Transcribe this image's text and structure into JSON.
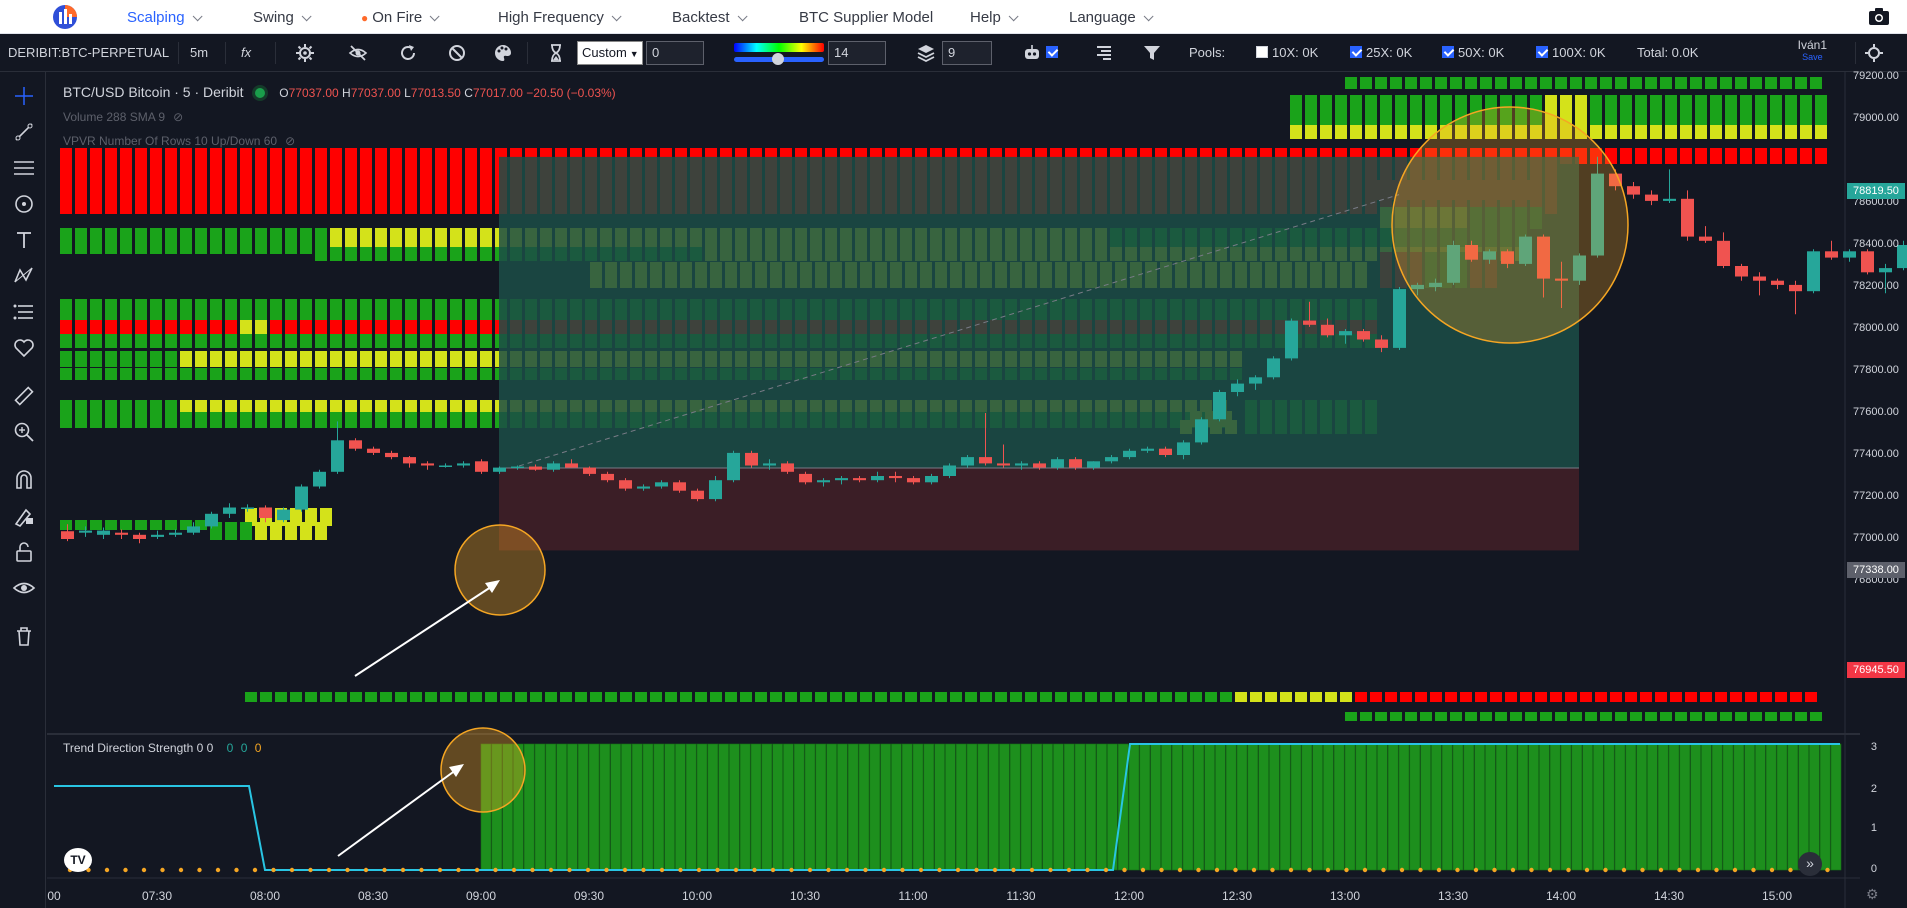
{
  "nav": {
    "items": [
      {
        "label": "Scalping",
        "active": true,
        "chevron": true
      },
      {
        "label": "Swing",
        "chevron": true
      },
      {
        "label": "On Fire",
        "chevron": true,
        "icon": "fire-icon"
      },
      {
        "label": "High Frequency",
        "chevron": true
      },
      {
        "label": "Backtest",
        "chevron": true
      },
      {
        "label": "BTC Supplier Model",
        "chevron": false
      },
      {
        "label": "Help",
        "chevron": true
      },
      {
        "label": "Language",
        "chevron": true
      }
    ],
    "camera_icon": "camera-icon"
  },
  "toolbar": {
    "symbol": "DERIBIT:BTC-PERPETUAL",
    "interval": "5m",
    "fx": "fx",
    "select_value": "Custom",
    "custom_input": "0",
    "gradient_input": "14",
    "layers_input": "9",
    "pools_label": "Pools:",
    "pools": [
      {
        "label": "10X: 0K",
        "checked": false
      },
      {
        "label": "25X: 0K",
        "checked": true
      },
      {
        "label": "50X: 0K",
        "checked": true
      },
      {
        "label": "100X: 0K",
        "checked": true
      }
    ],
    "total": "Total: 0.0K",
    "user": "Iván1",
    "user_save": "Save"
  },
  "legend": {
    "title": "BTC/USD Bitcoin · 5 · Deribit",
    "o_label": "O",
    "o": "77037.00",
    "h_label": "H",
    "h": "77037.00",
    "l_label": "L",
    "l": "77013.50",
    "c_label": "C",
    "c": "77017.00",
    "change": "−20.50 (−0.03%)",
    "volume": "Volume 288 SMA 9",
    "vpvr": "VPVR Number Of Rows 10 Up/Down 60"
  },
  "indicator": {
    "title": "Trend Direction Strength 0 0",
    "values": [
      "0",
      "0",
      "0"
    ],
    "axis_labels": [
      "3",
      "2",
      "1",
      "0"
    ]
  },
  "price_axis": {
    "labels": [
      "79200.00",
      "79000.00",
      "78600.00",
      "78400.00",
      "78200.00",
      "78000.00",
      "77800.00",
      "77600.00",
      "77400.00",
      "77200.00",
      "77000.00",
      "76800.00"
    ],
    "tag_top": "78819.50",
    "tag_mid": "77338.00",
    "tag_low": "76945.50"
  },
  "time_axis": {
    "labels": [
      "00",
      "07:30",
      "08:00",
      "08:30",
      "09:00",
      "09:30",
      "10:00",
      "10:30",
      "11:00",
      "11:30",
      "12:00",
      "12:30",
      "13:00",
      "13:30",
      "14:00",
      "14:30",
      "15:00"
    ]
  },
  "colors": {
    "up": "#26a69a",
    "down": "#f05350",
    "heat_red": "#ff0000",
    "heat_yellow": "#d4e21a",
    "heat_green": "#1aa31a",
    "profit_zone": "#1c4d46",
    "loss_zone": "#3d1f27",
    "circle": "#f5a623",
    "accent": "#2962ff"
  },
  "chart_data": {
    "type": "candlestick",
    "title": "BTC/USD Bitcoin · 5 · Deribit",
    "x_range": [
      "07:20",
      "15:20"
    ],
    "ylim": [
      76700,
      79300
    ],
    "candles": [
      [
        77037,
        77070,
        76990,
        77000
      ],
      [
        77030,
        77060,
        77010,
        77040
      ],
      [
        77020,
        77055,
        77000,
        77040
      ],
      [
        77030,
        77045,
        77000,
        77020
      ],
      [
        77020,
        77030,
        76980,
        77000
      ],
      [
        77010,
        77040,
        77000,
        77020
      ],
      [
        77020,
        77045,
        77010,
        77030
      ],
      [
        77030,
        77080,
        77020,
        77060
      ],
      [
        77060,
        77130,
        77050,
        77120
      ],
      [
        77120,
        77170,
        77100,
        77150
      ],
      [
        77150,
        77165,
        77130,
        77150
      ],
      [
        77150,
        77160,
        77080,
        77100
      ],
      [
        77090,
        77150,
        77080,
        77140
      ],
      [
        77140,
        77260,
        77130,
        77250
      ],
      [
        77250,
        77330,
        77240,
        77320
      ],
      [
        77320,
        77560,
        77310,
        77470
      ],
      [
        77470,
        77480,
        77420,
        77430
      ],
      [
        77430,
        77440,
        77400,
        77410
      ],
      [
        77410,
        77420,
        77380,
        77390
      ],
      [
        77390,
        77395,
        77340,
        77360
      ],
      [
        77360,
        77370,
        77330,
        77350
      ],
      [
        77350,
        77360,
        77340,
        77350
      ],
      [
        77350,
        77370,
        77340,
        77360
      ],
      [
        77370,
        77380,
        77310,
        77320
      ],
      [
        77320,
        77345,
        77310,
        77340
      ],
      [
        77340,
        77350,
        77330,
        77345
      ],
      [
        77345,
        77355,
        77325,
        77330
      ],
      [
        77330,
        77370,
        77320,
        77360
      ],
      [
        77360,
        77380,
        77340,
        77340
      ],
      [
        77340,
        77345,
        77300,
        77310
      ],
      [
        77310,
        77320,
        77270,
        77280
      ],
      [
        77280,
        77290,
        77230,
        77240
      ],
      [
        77240,
        77260,
        77230,
        77250
      ],
      [
        77250,
        77280,
        77240,
        77270
      ],
      [
        77270,
        77280,
        77220,
        77230
      ],
      [
        77230,
        77240,
        77180,
        77190
      ],
      [
        77190,
        77300,
        77180,
        77280
      ],
      [
        77280,
        77420,
        77270,
        77410
      ],
      [
        77410,
        77420,
        77340,
        77350
      ],
      [
        77350,
        77380,
        77330,
        77360
      ],
      [
        77360,
        77370,
        77310,
        77320
      ],
      [
        77310,
        77320,
        77260,
        77270
      ],
      [
        77270,
        77290,
        77250,
        77280
      ],
      [
        77280,
        77300,
        77260,
        77290
      ],
      [
        77290,
        77300,
        77270,
        77280
      ],
      [
        77280,
        77320,
        77270,
        77300
      ],
      [
        77300,
        77320,
        77270,
        77290
      ],
      [
        77290,
        77300,
        77260,
        77270
      ],
      [
        77270,
        77310,
        77260,
        77300
      ],
      [
        77300,
        77360,
        77290,
        77350
      ],
      [
        77350,
        77400,
        77340,
        77390
      ],
      [
        77390,
        77600,
        77350,
        77360
      ],
      [
        77360,
        77450,
        77340,
        77350
      ],
      [
        77350,
        77370,
        77330,
        77360
      ],
      [
        77360,
        77370,
        77330,
        77340
      ],
      [
        77340,
        77390,
        77330,
        77380
      ],
      [
        77380,
        77390,
        77330,
        77340
      ],
      [
        77340,
        77370,
        77330,
        77370
      ],
      [
        77370,
        77400,
        77360,
        77390
      ],
      [
        77390,
        77430,
        77380,
        77420
      ],
      [
        77420,
        77440,
        77410,
        77430
      ],
      [
        77430,
        77440,
        77390,
        77400
      ],
      [
        77400,
        77470,
        77380,
        77460
      ],
      [
        77460,
        77580,
        77450,
        77570
      ],
      [
        77570,
        77710,
        77560,
        77700
      ],
      [
        77700,
        77760,
        77680,
        77740
      ],
      [
        77740,
        77780,
        77710,
        77770
      ],
      [
        77770,
        77870,
        77760,
        77860
      ],
      [
        77860,
        78050,
        77850,
        78040
      ],
      [
        78040,
        78130,
        78010,
        78020
      ],
      [
        78020,
        78050,
        77960,
        77970
      ],
      [
        77970,
        78000,
        77930,
        77990
      ],
      [
        77990,
        78000,
        77940,
        77950
      ],
      [
        77950,
        77970,
        77890,
        77910
      ],
      [
        77910,
        78200,
        77900,
        78190
      ],
      [
        78190,
        78220,
        78160,
        78210
      ],
      [
        78200,
        78240,
        78180,
        78220
      ],
      [
        78220,
        78420,
        78210,
        78400
      ],
      [
        78400,
        78420,
        78320,
        78330
      ],
      [
        78330,
        78380,
        78310,
        78370
      ],
      [
        78370,
        78380,
        78290,
        78310
      ],
      [
        78310,
        78450,
        78300,
        78440
      ],
      [
        78440,
        78450,
        78150,
        78240
      ],
      [
        78240,
        78320,
        78100,
        78230
      ],
      [
        78230,
        78360,
        78210,
        78350
      ],
      [
        78350,
        78820,
        78340,
        78740
      ],
      [
        78740,
        78760,
        78660,
        78680
      ],
      [
        78680,
        78700,
        78620,
        78640
      ],
      [
        78640,
        78660,
        78590,
        78610
      ],
      [
        78610,
        78760,
        78600,
        78620
      ],
      [
        78620,
        78660,
        78420,
        78440
      ],
      [
        78440,
        78490,
        78410,
        78420
      ],
      [
        78420,
        78460,
        78290,
        78300
      ],
      [
        78300,
        78310,
        78230,
        78250
      ],
      [
        78250,
        78270,
        78160,
        78230
      ],
      [
        78230,
        78240,
        78190,
        78210
      ],
      [
        78210,
        78230,
        78070,
        78180
      ],
      [
        78180,
        78380,
        78170,
        78370
      ],
      [
        78370,
        78420,
        78330,
        78340
      ],
      [
        78340,
        78380,
        78320,
        78370
      ],
      [
        78370,
        78380,
        78260,
        78270
      ],
      [
        78270,
        78310,
        78170,
        78290
      ],
      [
        78290,
        78420,
        78280,
        78400
      ],
      [
        78400,
        78480,
        78390,
        78420
      ]
    ],
    "trade_box": {
      "entry": 77338,
      "target": 78819.5,
      "stop": 76945.5,
      "start": "09:05",
      "end": "14:05"
    },
    "trend_strength": {
      "from_09_00": 1,
      "line_level_start": 2,
      "line_level_end": 3,
      "line_rise": "11:55"
    }
  }
}
